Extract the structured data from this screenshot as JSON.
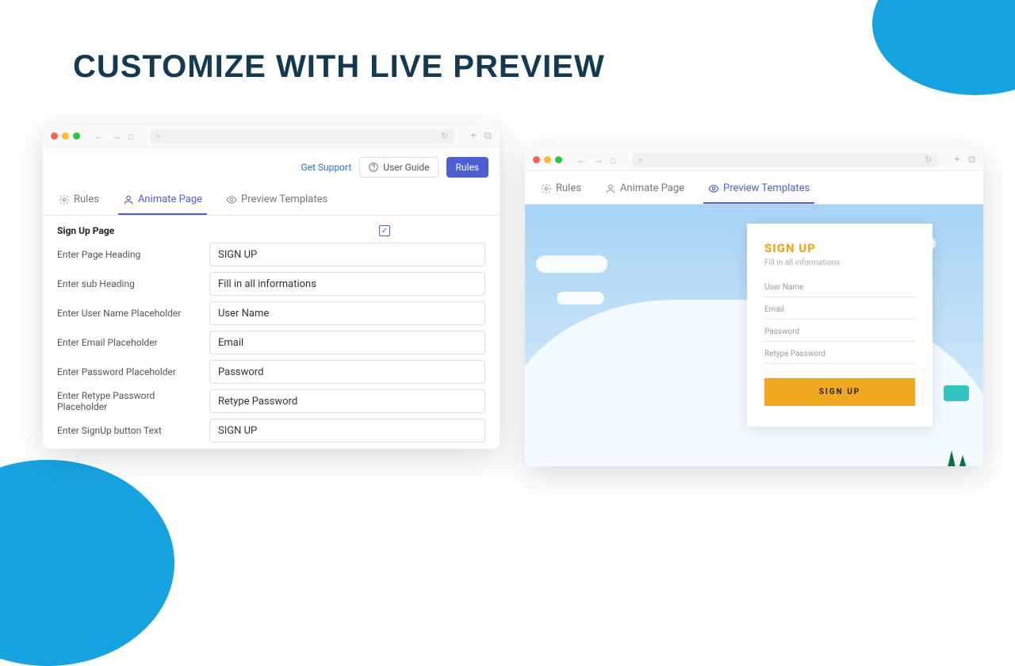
{
  "page_title": "CUSTOMIZE WITH LIVE PREVIEW",
  "browser": {
    "search_icon": "⌕",
    "reload_icon": "↻",
    "plus": "+",
    "copy": "⧉",
    "back": "←",
    "fwd": "→",
    "home": "⌂"
  },
  "header": {
    "support_link": "Get Support",
    "user_guide": "User Guide",
    "rules_btn": "Rules"
  },
  "tabs": {
    "rules": "Rules",
    "animate": "Animate Page",
    "preview": "Preview Templates"
  },
  "form": {
    "section": "Sign Up Page",
    "fields": [
      {
        "label": "Enter Page Heading",
        "value": "SIGN UP"
      },
      {
        "label": "Enter sub Heading",
        "value": "Fill in all informations"
      },
      {
        "label": "Enter User Name Placeholder",
        "value": "User Name"
      },
      {
        "label": "Enter Email Placeholder",
        "value": "Email"
      },
      {
        "label": "Enter Password Placeholder",
        "value": "Password"
      },
      {
        "label": "Enter Retype Password Placeholder",
        "value": "Retype Password"
      },
      {
        "label": "Enter SignUp button Text",
        "value": "SIGN UP"
      }
    ],
    "check": "✓"
  },
  "preview": {
    "title": "SIGN UP",
    "subtitle": "Fill in all informations",
    "fields": [
      "User Name",
      "Email",
      "Password",
      "Retype Password"
    ],
    "button": "SIGN UP"
  }
}
